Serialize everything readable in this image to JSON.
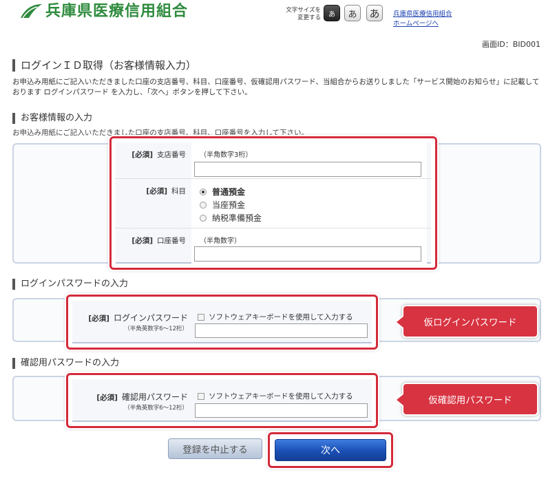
{
  "header": {
    "bank_name": "兵庫県医療信用組合",
    "font_size_label_line1": "文字サイズを",
    "font_size_label_line2": "変更する",
    "font_sizes": [
      "あ",
      "あ",
      "あ"
    ],
    "home_link_line1": "兵庫県医療信用組合",
    "home_link_line2": "ホームページへ"
  },
  "screen_id": "画面ID：BID001",
  "page_title": "ログインＩＤ取得（お客様情報入力）",
  "intro": "お申込み用紙にご記入いただきました口座の支店番号、科目、口座番号、仮確認用パスワード、当組合からお送りしました「サービス開始のお知らせ」に記載しております ログインパスワード を入力し、「次へ」ボタンを押して下さい。",
  "customer_section": {
    "title": "お客様情報の入力",
    "description": "お申込み用紙にご記入いただきました口座の支店番号、科目、口座番号を入力して下さい。",
    "required_tag": "[必須]",
    "branch_label": "支店番号",
    "branch_hint": "（半角数字3桁）",
    "branch_value": "",
    "subject_label": "科目",
    "subject_options": [
      "普通預金",
      "当座預金",
      "納税準備預金"
    ],
    "subject_selected": "普通預金",
    "account_label": "口座番号",
    "account_hint": "（半角数字）",
    "account_value": ""
  },
  "login_section": {
    "title": "ログインパスワードの入力",
    "required_tag": "[必須]",
    "label": "ログインパスワード",
    "sublabel": "（半角英数字6～12桁）",
    "software_kb": "ソフトウェアキーボードを使用して入力する",
    "value": "",
    "callout": "仮ログインパスワード"
  },
  "confirm_section": {
    "title": "確認用パスワードの入力",
    "required_tag": "[必須]",
    "label": "確認用パスワード",
    "sublabel": "（半角英数字6～12桁）",
    "software_kb": "ソフトウェアキーボードを使用して入力する",
    "value": "",
    "callout": "仮確認用パスワード"
  },
  "buttons": {
    "cancel": "登録を中止する",
    "next": "次へ"
  },
  "colors": {
    "brand_green": "#2e8b3e",
    "highlight_red": "#d42a3a",
    "next_blue": "#1a4fb4"
  }
}
